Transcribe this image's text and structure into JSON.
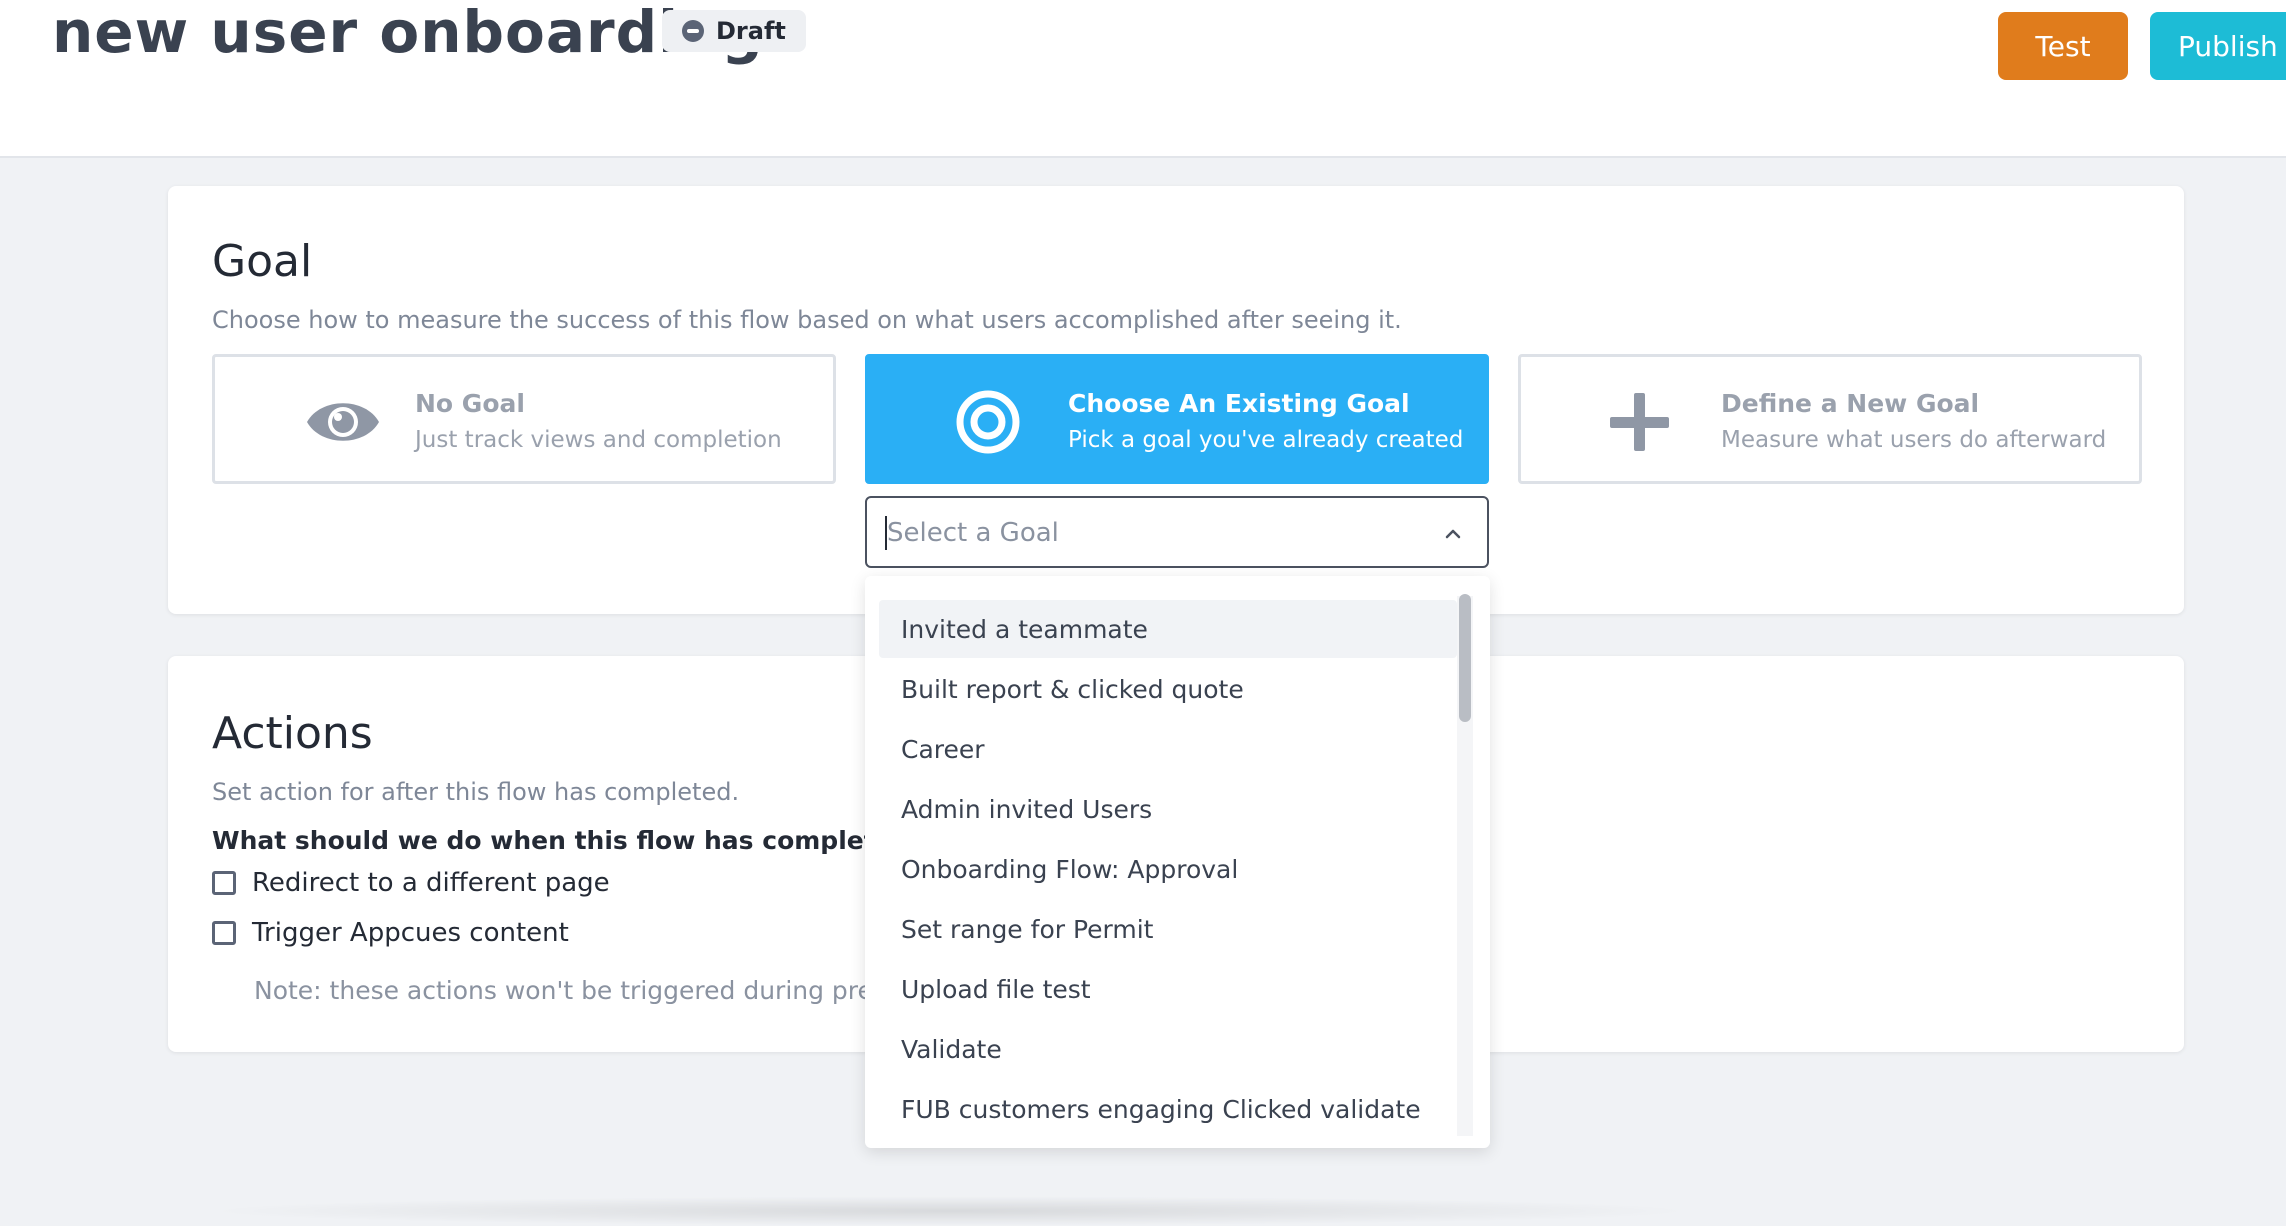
{
  "header": {
    "title": "new user onboarding",
    "status_badge": "Draft",
    "test_label": "Test",
    "publish_label": "Publish"
  },
  "colors": {
    "test_button": "#e07c1c",
    "publish_button": "#1dbcd6",
    "selected_option": "#2aaff5"
  },
  "goal": {
    "title": "Goal",
    "subtitle": "Choose how to measure the success of this flow based on what users accomplished after seeing it.",
    "options": [
      {
        "icon": "eye-icon",
        "title": "No Goal",
        "description": "Just track views and completion",
        "selected": false
      },
      {
        "icon": "target-icon",
        "title": "Choose An Existing Goal",
        "description": "Pick a goal you've already created",
        "selected": true
      },
      {
        "icon": "plus-icon",
        "title": "Define a New Goal",
        "description": "Measure what users do afterward",
        "selected": false
      }
    ],
    "select": {
      "placeholder": "Select a Goal",
      "icon": "chevron-up-icon"
    },
    "dropdown_items": [
      "Invited a teammate",
      "Built report & clicked quote",
      "Career",
      "Admin invited Users",
      "Onboarding Flow: Approval",
      "Set range for Permit",
      "Upload file test",
      "Validate",
      "FUB customers engaging Clicked validate"
    ]
  },
  "actions": {
    "title": "Actions",
    "subtitle": "Set action for after this flow has completed.",
    "question": "What should we do when this flow has completed?",
    "checkboxes": [
      {
        "label": "Redirect to a different page",
        "checked": false
      },
      {
        "label": "Trigger Appcues content",
        "checked": false
      }
    ],
    "note": "Note: these actions won't be triggered during previev"
  }
}
